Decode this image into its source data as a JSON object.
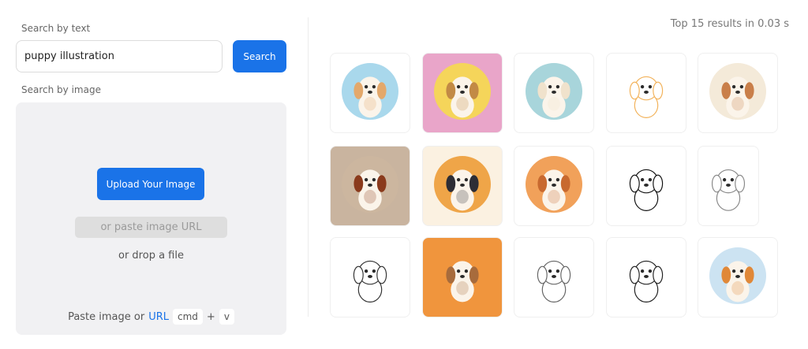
{
  "search_text": {
    "label": "Search by text",
    "value": "puppy illustration",
    "button_label": "Search"
  },
  "search_image": {
    "label": "Search by image",
    "upload_label": "Upload Your Image",
    "url_placeholder": "or paste image URL",
    "drop_label": "or drop a file",
    "paste_prefix": "Paste image or",
    "paste_link": "URL",
    "key_cmd": "cmd",
    "key_plus": "+",
    "key_v": "v"
  },
  "results": {
    "summary": "Top 15 results in 0.03 s",
    "items": [
      {
        "icon": "puppy-sitting-blue-circle-icon",
        "bg": "#ffffff",
        "accent": "#a9d8ec",
        "fur": "#e3a86b"
      },
      {
        "icon": "beagle-portrait-pink-icon",
        "bg": "#e9a5c9",
        "accent": "#f5d55a",
        "fur": "#c28a45"
      },
      {
        "icon": "puppy-on-table-icon",
        "bg": "#ffffff",
        "accent": "#a8d5db",
        "fur": "#f0e2cc"
      },
      {
        "icon": "orange-puppy-standing-icon",
        "bg": "#ffffff",
        "accent": "#ffffff",
        "fur": "#f2b25a"
      },
      {
        "icon": "puppy-sitting-beige-icon",
        "bg": "#ffffff",
        "accent": "#f4ead9",
        "fur": "#c97f4a"
      },
      {
        "icon": "cavalier-spaniel-icon",
        "bg": "#c9b49f",
        "accent": "#ccb69f",
        "fur": "#8a3a1c"
      },
      {
        "icon": "girl-with-puppy-icon",
        "bg": "#fbf1e1",
        "accent": "#efa548",
        "fur": "#2d2d35"
      },
      {
        "icon": "puppy-orange-circle-icon",
        "bg": "#ffffff",
        "accent": "#f1a15a",
        "fur": "#c8692f"
      },
      {
        "icon": "boy-with-puppy-lineart-icon",
        "bg": "#ffffff",
        "accent": "#ffffff",
        "fur": "#111111"
      },
      {
        "icon": "fluffy-puppy-lineart-icon",
        "bg": "#ffffff",
        "accent": "#ffffff",
        "fur": "#888888"
      },
      {
        "icon": "running-puppies-lineart-icon",
        "bg": "#ffffff",
        "accent": "#ffffff",
        "fur": "#333333"
      },
      {
        "icon": "puppy-orange-square-icon",
        "bg": "#f0953d",
        "accent": "#f0953d",
        "fur": "#a76b3c"
      },
      {
        "icon": "puppies-lineart-sketch-icon",
        "bg": "#ffffff",
        "accent": "#ffffff",
        "fur": "#666666"
      },
      {
        "icon": "puppy-flowers-lineart-icon",
        "bg": "#ffffff",
        "accent": "#ffffff",
        "fur": "#222222"
      },
      {
        "icon": "orange-puppy-blue-circle-icon",
        "bg": "#ffffff",
        "accent": "#cce3f2",
        "fur": "#e08838"
      }
    ]
  }
}
